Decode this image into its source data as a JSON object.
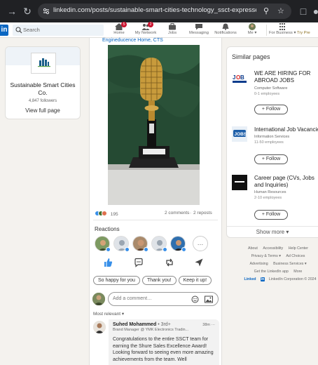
{
  "browser": {
    "url": "linkedin.com/posts/sustainable-smart-cities-technology_ssct-expresses-heartf..."
  },
  "header": {
    "logo": "in",
    "search_placeholder": "Search",
    "nav": [
      {
        "label": "Home",
        "badge": "5"
      },
      {
        "label": "My Network",
        "badge": "2"
      },
      {
        "label": "Jobs",
        "badge": ""
      },
      {
        "label": "Messaging",
        "badge": ""
      },
      {
        "label": "Notifications",
        "badge": ""
      },
      {
        "label": "Me ▾",
        "badge": ""
      },
      {
        "label": "For Business ▾",
        "badge": ""
      },
      {
        "label": "Try Pre",
        "badge": ""
      }
    ]
  },
  "company_card": {
    "name": "Sustainable Smart Cities Co.",
    "followers": "4,847 followers",
    "view_full_page": "View full page"
  },
  "post": {
    "cutline": "Engineducence Home, CTS",
    "reaction_count": "195",
    "comments": "2 comments",
    "reposts": "2 reposts",
    "reactions_title": "Reactions",
    "chips": [
      "So happy for you",
      "Thank you!",
      "Keep it up!"
    ],
    "comment_placeholder": "Add a comment…",
    "sort_label": "Most relevant ▾"
  },
  "comment": {
    "author": "Suhed Mohammed",
    "degree": "• 3rd+",
    "headline": "Brand Manager @ YMK Electronics Tradin...",
    "time": "38m ···",
    "text": "Congratulations to the entire SSCT team for earning the Shure Sales Excellence Award! Looking forward to seeing even more amazing achievements from the team. Well"
  },
  "similar_pages": {
    "title": "Similar pages",
    "items": [
      {
        "name": "WE ARE HIRING FOR ABROAD JOBS",
        "category": "Computer Software",
        "employees": "0-1 employees",
        "follow": "+ Follow"
      },
      {
        "name": "International Job Vacancies",
        "category": "Information Services",
        "employees": "11-50 employees",
        "follow": "+ Follow"
      },
      {
        "name": "Career page (CVs, Jobs and Inquiries)",
        "category": "Human Resources",
        "employees": "2-10 employees",
        "follow": "+ Follow"
      }
    ],
    "show_more": "Show more ▾"
  },
  "footer": {
    "links": [
      "About",
      "Accessibility",
      "Help Center",
      "Privacy & Terms ▾",
      "Ad Choices",
      "Advertising",
      "Business Services ▾",
      "Get the LinkedIn app",
      "More"
    ],
    "brand": "Linked",
    "copyright": "LinkedIn Corporation © 2024"
  },
  "colors": {
    "brand": "#0a66c2",
    "page_bg": "#f4f2ee",
    "chrome_bg": "#202124"
  }
}
